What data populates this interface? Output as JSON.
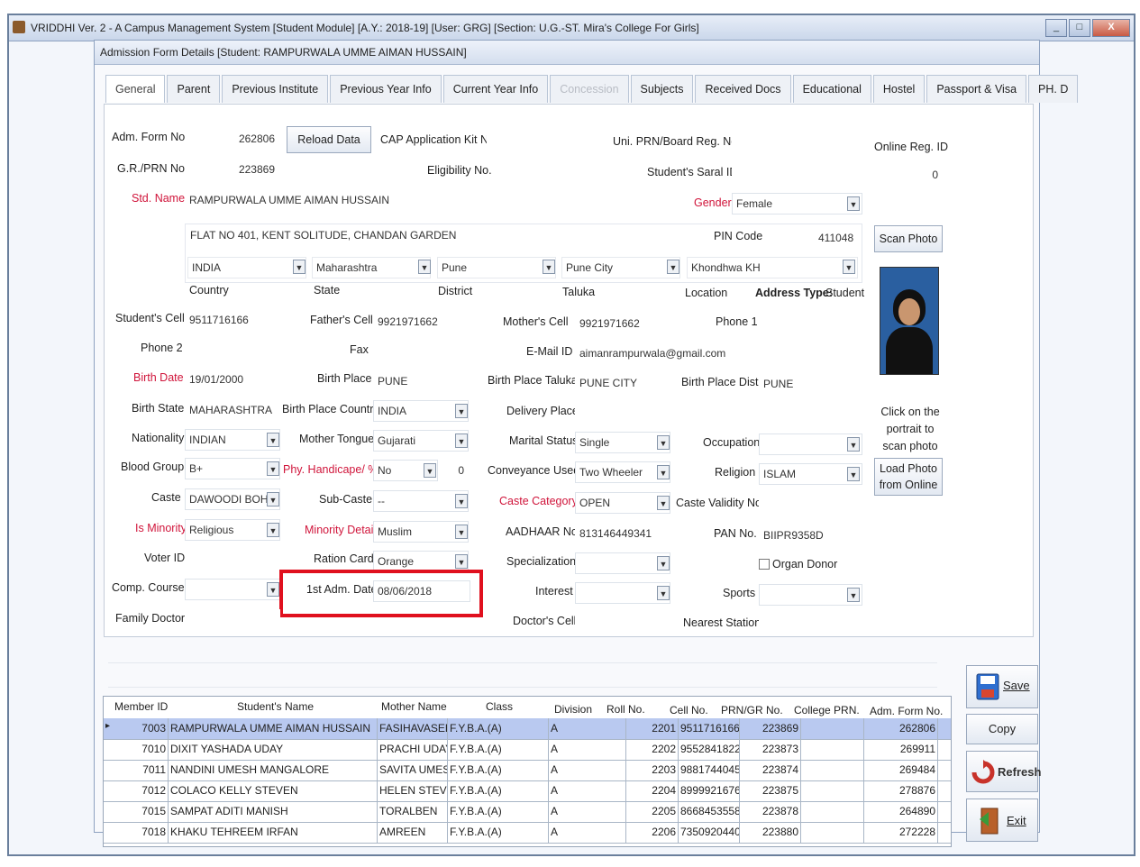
{
  "window": {
    "title": "VRIDDHI Ver. 2 - A Campus Management System [Student Module] [A.Y.: 2018-19] [User: GRG] [Section: U.G.-ST. Mira's College For Girls]",
    "min": "_",
    "max": "□",
    "close": "X"
  },
  "form_title": "Admission Form Details [Student: RAMPURWALA UMME AIMAN HUSSAIN]",
  "tabs": [
    "General",
    "Parent",
    "Previous Institute",
    "Previous Year Info",
    "Current Year Info",
    "Concession",
    "Subjects",
    "Received Docs",
    "Educational",
    "Hostel",
    "Passport & Visa",
    "PH. D"
  ],
  "labels": {
    "adm_form_no": "Adm. Form No.",
    "reload": "Reload Data",
    "cap_kit": "CAP Application Kit No.",
    "uni_prn": "Uni. PRN/Board Reg. No.",
    "online_reg": "Online Reg. ID",
    "gr_prn": "G.R./PRN No.",
    "eligibility": "Eligibility No.",
    "saral": "Student's Saral ID",
    "std_name": "Std. Name",
    "gender": "Gender",
    "pin": "PIN Code",
    "scan_photo": "Scan Photo",
    "country": "Country",
    "state": "State",
    "district": "District",
    "taluka": "Taluka",
    "location": "Location",
    "address_type": "Address Type:",
    "address_type_val": "Student",
    "student_cell": "Student's Cell",
    "father_cell": "Father's Cell",
    "mother_cell": "Mother's Cell",
    "phone1": "Phone 1",
    "phone2": "Phone 2",
    "fax": "Fax",
    "email": "E-Mail ID",
    "birth_date": "Birth Date",
    "birth_place": "Birth Place",
    "bp_taluka": "Birth Place Taluka",
    "bp_dist": "Birth Place Dist.",
    "birth_state": "Birth State",
    "bp_country": "Birth Place Country",
    "delivery_place": "Delivery Place",
    "click_portrait": "Click on the portrait to scan photo",
    "nationality": "Nationality",
    "mother_tongue": "Mother Tongue",
    "marital": "Marital Status",
    "occupation": "Occupation",
    "blood": "Blood Group",
    "phy_handicap": "Phy. Handicape/ %",
    "conveyance": "Conveyance Used",
    "religion": "Religion",
    "load_photo": "Load Photo from Online",
    "caste": "Caste",
    "subcaste": "Sub-Caste",
    "caste_cat": "Caste Category",
    "caste_validity": "Caste Validity No.",
    "is_minority": "Is Minority",
    "minority_detail": "Minority Detail",
    "aadhaar": "AADHAAR No.",
    "pan": "PAN No.",
    "voter": "Voter ID",
    "ration": "Ration Card",
    "specialization": "Specialization",
    "organ_donor": "Organ Donor",
    "comp_course": "Comp. Course",
    "first_adm": "1st Adm. Date",
    "interest": "Interest",
    "sports": "Sports",
    "family_doctor": "Family Doctor",
    "doctor_cell": "Doctor's Cell",
    "nearest_station": "Nearest Station"
  },
  "values": {
    "adm_form_no": "262806",
    "gr_prn": "223869",
    "online_reg": "0",
    "std_name": "RAMPURWALA UMME AIMAN HUSSAIN",
    "gender": "Female",
    "address": "FLAT NO 401, KENT SOLITUDE, CHANDAN GARDEN",
    "pin": "411048",
    "country": "INDIA",
    "state": "Maharashtra",
    "district": "Pune",
    "taluka": "Pune City",
    "location": "Khondhwa KH",
    "student_cell": "9511716166",
    "father_cell": "9921971662",
    "mother_cell": "9921971662",
    "email": "aimanrampurwala@gmail.com",
    "birth_date": "19/01/2000",
    "birth_place": "PUNE",
    "bp_taluka": "PUNE CITY",
    "bp_dist": "PUNE",
    "birth_state": "MAHARASHTRA",
    "bp_country": "INDIA",
    "nationality": "INDIAN",
    "mother_tongue": "Gujarati",
    "marital": "Single",
    "blood": "B+",
    "phy_handicap": "No",
    "phy_pct": "0",
    "conveyance": "Two Wheeler",
    "religion": "ISLAM",
    "caste": "DAWOODI BOHRA",
    "subcaste": "--",
    "caste_cat": "OPEN",
    "is_minority": "Religious",
    "minority_detail": "Muslim",
    "aadhaar": "813146449341",
    "pan": "BIIPR9358D",
    "ration": "Orange",
    "first_adm": "08/06/2018"
  },
  "grid": {
    "headers": [
      "Member ID",
      "Student's Name",
      "Mother Name",
      "Class",
      "Division",
      "Roll No.",
      "Cell No.",
      "PRN/GR No.",
      "College PRN.",
      "Adm. Form No."
    ],
    "rows": [
      [
        "7003",
        "RAMPURWALA UMME AIMAN HUSSAIN",
        "FASIHAVASEEM",
        "F.Y.B.A.(A)",
        "A",
        "2201",
        "9511716166",
        "223869",
        "",
        "262806"
      ],
      [
        "7010",
        "DIXIT YASHADA UDAY",
        "PRACHI UDAY",
        "F.Y.B.A.(A)",
        "A",
        "2202",
        "9552841822",
        "223873",
        "",
        "269911"
      ],
      [
        "7011",
        "NANDINI UMESH MANGALORE",
        "SAVITA UMESH",
        "F.Y.B.A.(A)",
        "A",
        "2203",
        "9881744045",
        "223874",
        "",
        "269484"
      ],
      [
        "7012",
        "COLACO KELLY STEVEN",
        "HELEN STEVE",
        "F.Y.B.A.(A)",
        "A",
        "2204",
        "8999921676",
        "223875",
        "",
        "278876"
      ],
      [
        "7015",
        "SAMPAT ADITI MANISH",
        "TORALBEN",
        "F.Y.B.A.(A)",
        "A",
        "2205",
        "8668453558",
        "223878",
        "",
        "264890"
      ],
      [
        "7018",
        "KHAKU TEHREEM IRFAN",
        "AMREEN",
        "F.Y.B.A.(A)",
        "A",
        "2206",
        "7350920440",
        "223880",
        "",
        "272228"
      ]
    ]
  },
  "side_buttons": {
    "save": "Save",
    "copy_subjects": "Copy Subjects",
    "refresh": "Refresh",
    "exit": "Exit"
  },
  "dropdown_glyph": "▼",
  "row_pointer": "▸"
}
